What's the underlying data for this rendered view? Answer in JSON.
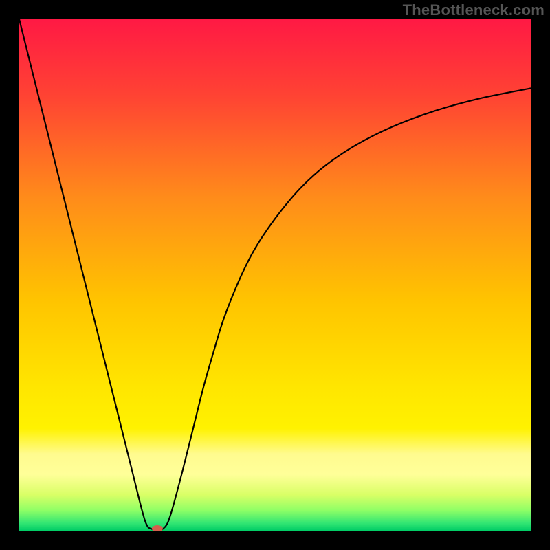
{
  "watermark": "TheBottleneck.com",
  "chart_data": {
    "type": "line",
    "title": "",
    "xlabel": "",
    "ylabel": "",
    "xlim": [
      0,
      100
    ],
    "ylim": [
      0,
      100
    ],
    "gradient": {
      "stops": [
        {
          "offset": 0.0,
          "color": "#ff1944"
        },
        {
          "offset": 0.15,
          "color": "#ff4333"
        },
        {
          "offset": 0.35,
          "color": "#ff8c1a"
        },
        {
          "offset": 0.55,
          "color": "#ffc400"
        },
        {
          "offset": 0.72,
          "color": "#ffe600"
        },
        {
          "offset": 0.8,
          "color": "#fff200"
        },
        {
          "offset": 0.85,
          "color": "#fffb8f"
        },
        {
          "offset": 0.89,
          "color": "#ffff99"
        },
        {
          "offset": 0.93,
          "color": "#d9ff66"
        },
        {
          "offset": 0.96,
          "color": "#8fff66"
        },
        {
          "offset": 0.985,
          "color": "#33e673"
        },
        {
          "offset": 1.0,
          "color": "#00cc66"
        }
      ]
    },
    "series": [
      {
        "name": "bottleneck-curve",
        "x": [
          0,
          2,
          4,
          6,
          8,
          10,
          12,
          14,
          16,
          18,
          20,
          22,
          24,
          25,
          26,
          27,
          28,
          29,
          30,
          32,
          34,
          36,
          38,
          40,
          43,
          46,
          50,
          55,
          60,
          66,
          73,
          81,
          90,
          100
        ],
        "y": [
          100,
          92.0,
          84.0,
          76.0,
          68.0,
          60.0,
          52.0,
          44.0,
          36.0,
          28.0,
          20.0,
          12.0,
          4.0,
          1.0,
          0.3,
          0.0,
          0.3,
          1.5,
          4.5,
          12.0,
          20.0,
          28.0,
          35.0,
          41.5,
          49.0,
          55.0,
          61.0,
          67.0,
          71.5,
          75.5,
          79.0,
          82.0,
          84.5,
          86.5
        ]
      }
    ],
    "marker": {
      "name": "optimal-point",
      "x": 27,
      "y": 0
    }
  }
}
